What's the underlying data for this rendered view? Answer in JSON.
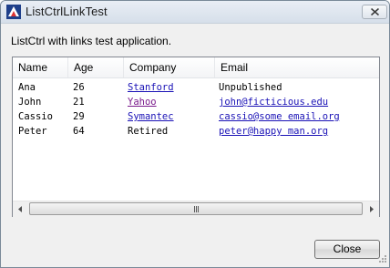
{
  "window": {
    "title": "ListCtrlLinkTest",
    "description": "ListCtrl with links test application."
  },
  "columns": [
    "Name",
    "Age",
    "Company",
    "Email"
  ],
  "rows": [
    {
      "name": "Ana",
      "age": "26",
      "company": "Stanford",
      "company_link": true,
      "email": "Unpublished",
      "email_link": false
    },
    {
      "name": "John",
      "age": "21",
      "company": "Yahoo",
      "company_link": true,
      "email": "john@ficticious.edu",
      "email_link": true
    },
    {
      "name": "Cassio",
      "age": "29",
      "company": "Symantec",
      "company_link": true,
      "email": "cassio@some email.org",
      "email_link": true
    },
    {
      "name": "Peter",
      "age": "64",
      "company": "Retired",
      "company_link": false,
      "email": "peter@happy man.org",
      "email_link": true
    }
  ],
  "buttons": {
    "close": "Close"
  },
  "scrollbar": {
    "grip_glyph": "III"
  },
  "colors": {
    "link": "#1a12b6",
    "visited_link": "#7a1a8c"
  }
}
